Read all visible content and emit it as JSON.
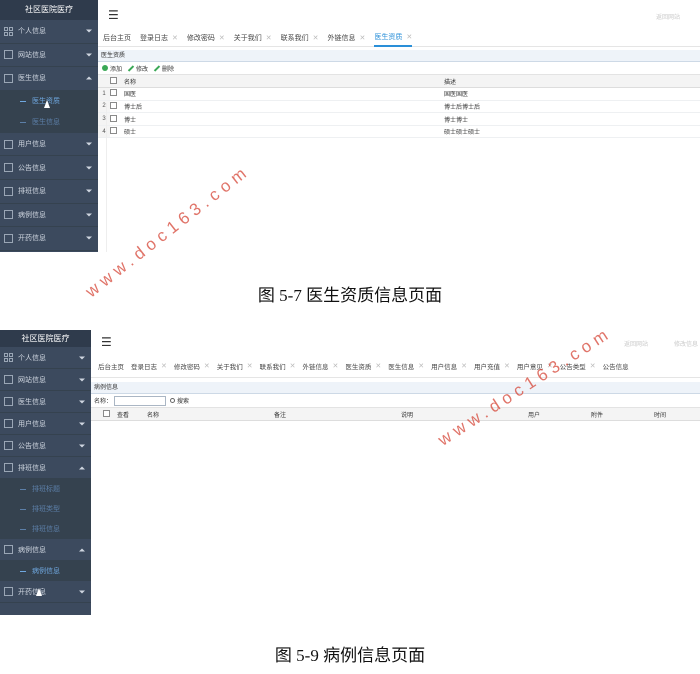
{
  "figure1": {
    "caption": "图 5-7 医生资质信息页面",
    "sidebar": {
      "title": "社区医院医疗",
      "items": [
        {
          "label": "个人信息",
          "icon": "grid-icon",
          "caret": "down"
        },
        {
          "label": "网站信息",
          "icon": "list-icon",
          "caret": "down"
        },
        {
          "label": "医生信息",
          "icon": "list-icon",
          "caret": "up"
        },
        {
          "label": "用户信息",
          "icon": "list-icon",
          "caret": "down"
        },
        {
          "label": "公告信息",
          "icon": "list-icon",
          "caret": "down"
        },
        {
          "label": "排班信息",
          "icon": "list-icon",
          "caret": "down"
        },
        {
          "label": "病例信息",
          "icon": "list-icon",
          "caret": "down"
        },
        {
          "label": "开药信息",
          "icon": "list-icon",
          "caret": "down"
        }
      ],
      "subitems": [
        "医生资质",
        "医生信息"
      ]
    },
    "top_link": "返回网站",
    "tabs": [
      "后台主页",
      "登录日志",
      "修改密码",
      "关于我们",
      "联系我们",
      "外链信息",
      "医生资质"
    ],
    "active_tab": "医生资质",
    "panel_title": "医生资质",
    "toolbar": {
      "add": "添加",
      "edit": "修改",
      "delete": "删除"
    },
    "columns": [
      "名称",
      "描述"
    ],
    "rows": [
      {
        "num": "1",
        "name": "国医",
        "desc": "国医国医"
      },
      {
        "num": "2",
        "name": "博士后",
        "desc": "博士后博士后"
      },
      {
        "num": "3",
        "name": "博士",
        "desc": "博士博士"
      },
      {
        "num": "4",
        "name": "硕士",
        "desc": "硕士硕士硕士"
      }
    ]
  },
  "figure2": {
    "caption": "图 5-9 病例信息页面",
    "sidebar": {
      "title": "社区医院医疗",
      "items_top": [
        {
          "label": "个人信息",
          "icon": "grid-icon",
          "caret": "down"
        },
        {
          "label": "网站信息",
          "icon": "list-icon",
          "caret": "down"
        },
        {
          "label": "医生信息",
          "icon": "list-icon",
          "caret": "down"
        },
        {
          "label": "用户信息",
          "icon": "list-icon",
          "caret": "down"
        },
        {
          "label": "公告信息",
          "icon": "list-icon",
          "caret": "down"
        }
      ],
      "schedule": {
        "label": "排班信息",
        "icon": "list-icon",
        "caret": "up",
        "subitems": [
          "排班标题",
          "排班类型",
          "排班信息"
        ]
      },
      "cases": {
        "label": "病例信息",
        "icon": "list-icon",
        "caret": "up",
        "subitems": [
          "病例信息"
        ]
      },
      "prescribe": {
        "label": "开药信息",
        "icon": "list-icon",
        "caret": "down"
      }
    },
    "top_links": [
      "返回网站",
      "修改信息"
    ],
    "tabs": [
      "后台主页",
      "登录日志",
      "修改密码",
      "关于我们",
      "联系我们",
      "外链信息",
      "医生资质",
      "医生信息",
      "用户信息",
      "用户充值",
      "用户意见",
      "公告类型",
      "公告信息"
    ],
    "panel_title": "病例信息",
    "search": {
      "label": "名称：",
      "button": "搜索"
    },
    "columns": [
      "查看",
      "名称",
      "备注",
      "说明",
      "用户",
      "附件",
      "时间"
    ]
  },
  "watermark": "www.doc163.com"
}
